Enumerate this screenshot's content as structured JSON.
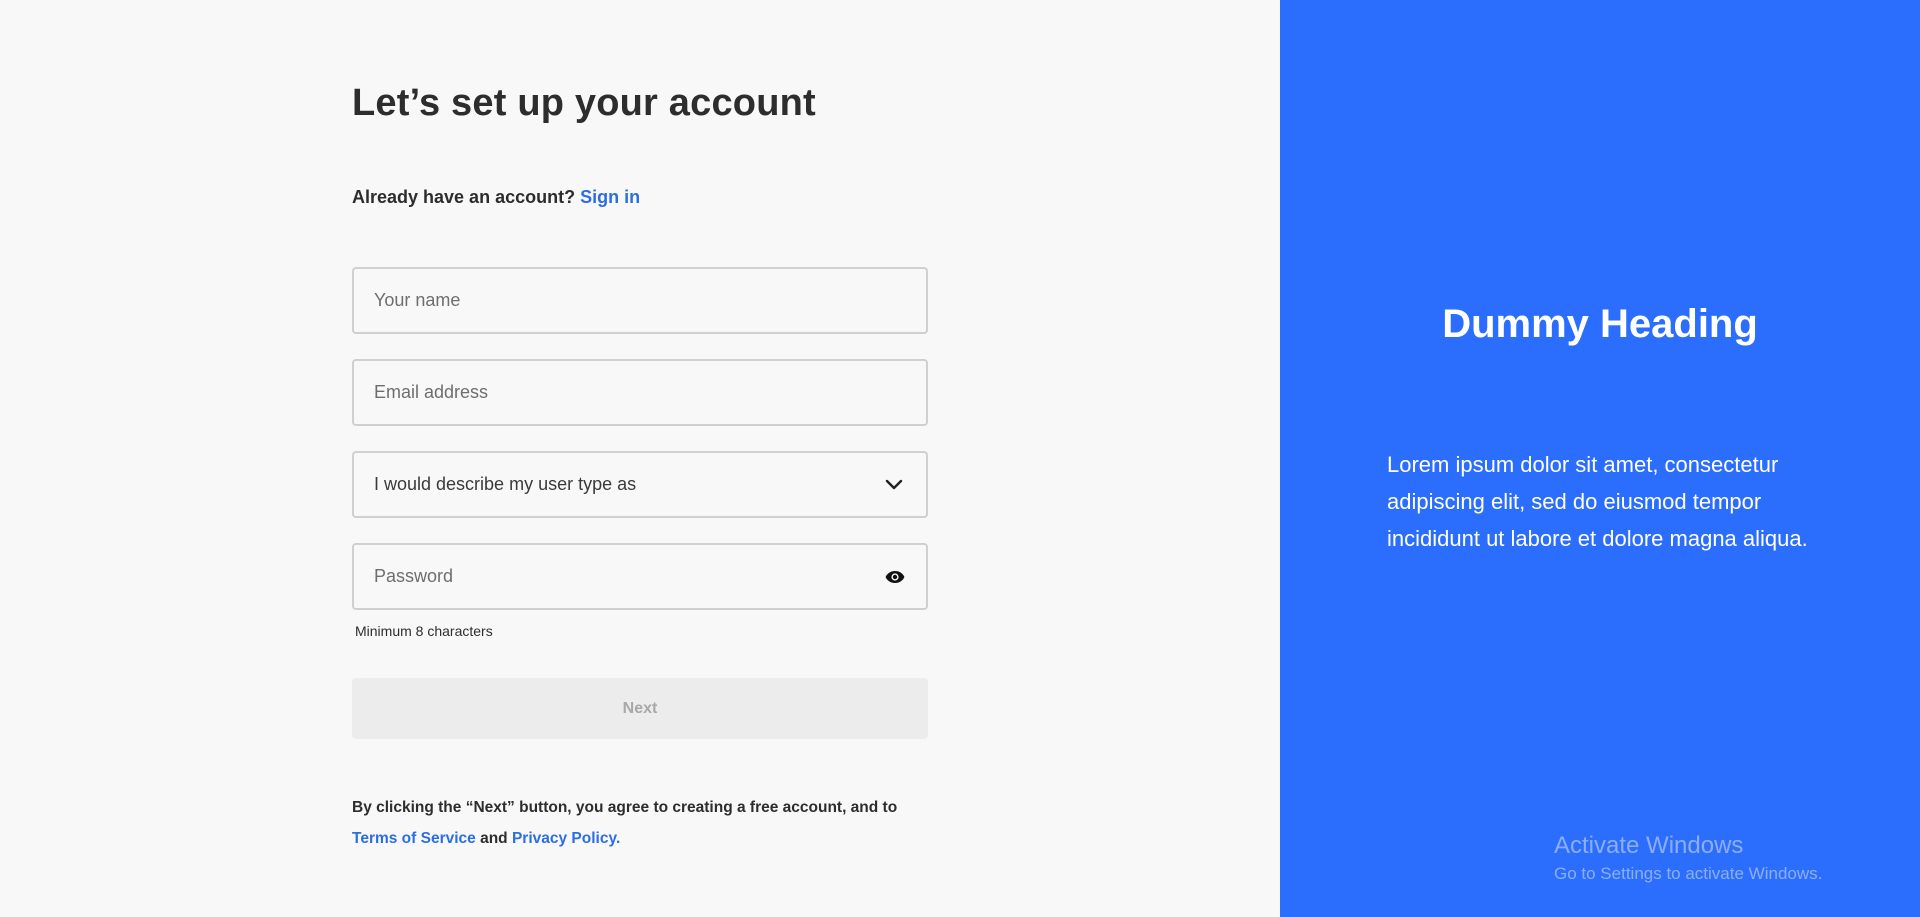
{
  "form": {
    "title": "Let’s set up your account",
    "signin_prompt": "Already have an account?",
    "signin_link": "Sign in",
    "name_placeholder": "Your name",
    "email_placeholder": "Email address",
    "user_type_value": "I would describe my user type as",
    "password_placeholder": "Password",
    "password_hint": "Minimum 8 characters",
    "next_label": "Next",
    "legal_text": "By clicking the “Next” button, you agree to creating a free account, and to",
    "terms_link": "Terms of Service",
    "legal_and": "and",
    "privacy_link": "Privacy Policy."
  },
  "promo": {
    "heading": "Dummy Heading",
    "body": "Lorem ipsum dolor sit amet, consectetur adipiscing elit, sed do eiusmod tempor incididunt ut labore et dolore magna aliqua."
  },
  "watermark": {
    "title": "Activate Windows",
    "subtitle": "Go to Settings to activate Windows."
  },
  "icons": {
    "select": "chevron-down-icon",
    "password_toggle": "eye-icon"
  },
  "colors": {
    "accent": "#2b6ee3",
    "panel_bg": "#2b6efd",
    "page_bg": "#f8f8f8"
  }
}
